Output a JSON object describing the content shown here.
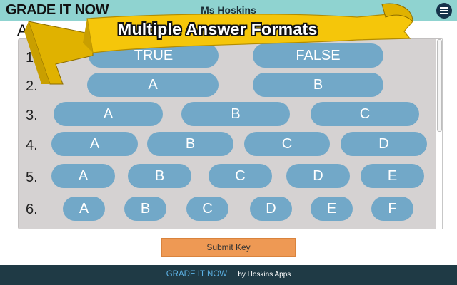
{
  "header": {
    "logo": "GRADE IT NOW",
    "teacher": "Ms Hoskins",
    "menu_icon": "hamburger-menu-icon"
  },
  "partial_heading": "A",
  "banner": {
    "text": "Multiple Answer Formats"
  },
  "answer_rows": [
    {
      "number": "1.",
      "options": [
        "TRUE",
        "FALSE"
      ]
    },
    {
      "number": "2.",
      "options": [
        "A",
        "B"
      ]
    },
    {
      "number": "3.",
      "options": [
        "A",
        "B",
        "C"
      ]
    },
    {
      "number": "4.",
      "options": [
        "A",
        "B",
        "C",
        "D"
      ]
    },
    {
      "number": "5.",
      "options": [
        "A",
        "B",
        "C",
        "D",
        "E"
      ]
    },
    {
      "number": "6.",
      "options": [
        "A",
        "B",
        "C",
        "D",
        "E",
        "F"
      ]
    }
  ],
  "submit": {
    "label": "Submit Key"
  },
  "footer": {
    "brand": "GRADE IT NOW",
    "by": "by Hoskins Apps"
  },
  "colors": {
    "header_bg": "#8fd3d0",
    "pill": "#72a8c8",
    "panel": "#d5d2d2",
    "submit": "#ee9954",
    "footer_bg": "#1f3a45",
    "footer_brand": "#5db3e6",
    "ribbon": "#f5c60a"
  }
}
